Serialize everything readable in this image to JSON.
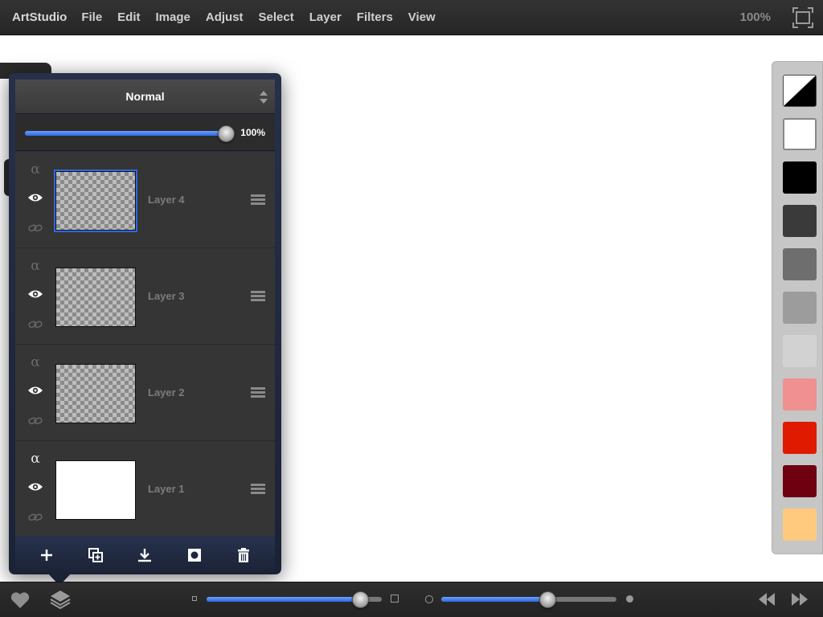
{
  "menubar": {
    "app_name": "ArtStudio",
    "menus": [
      "File",
      "Edit",
      "Image",
      "Adjust",
      "Select",
      "Layer",
      "Filters",
      "View"
    ],
    "zoom_level": "100%",
    "fullscreen_icon": "fullscreen-icon"
  },
  "layers_panel": {
    "blend_mode": "Normal",
    "opacity": {
      "label": "100%",
      "fraction": 1.0
    },
    "layers": [
      {
        "name": "Layer 4",
        "alpha_lock": false,
        "visible": true,
        "selected": true,
        "thumbnail": "transparent"
      },
      {
        "name": "Layer 3",
        "alpha_lock": false,
        "visible": true,
        "selected": false,
        "thumbnail": "transparent"
      },
      {
        "name": "Layer 2",
        "alpha_lock": false,
        "visible": true,
        "selected": false,
        "thumbnail": "transparent"
      },
      {
        "name": "Layer 1",
        "alpha_lock": true,
        "visible": true,
        "selected": false,
        "thumbnail": "white"
      }
    ],
    "alpha_glyph": "α",
    "tools": [
      "add-layer-icon",
      "duplicate-layer-icon",
      "merge-down-icon",
      "mask-icon",
      "trash-icon"
    ]
  },
  "palette": {
    "swatches": [
      "bw",
      "#ffffff",
      "#000000",
      "#3a3a3a",
      "#6e6e6e",
      "#9c9c9c",
      "#d2d2d2",
      "#f09090",
      "#e01a00",
      "#6e0010",
      "#ffc97e"
    ]
  },
  "bottombar": {
    "brush_size_fraction": 0.88,
    "brush_opacity_fraction": 0.61,
    "icons": [
      "heart-icon",
      "layers-icon",
      "rewind-icon",
      "fast-forward-icon"
    ]
  },
  "colors": {
    "accent": "#2f67e0",
    "panel_bg": "#1a2236",
    "menubar_bg": "#2a2a2a"
  }
}
